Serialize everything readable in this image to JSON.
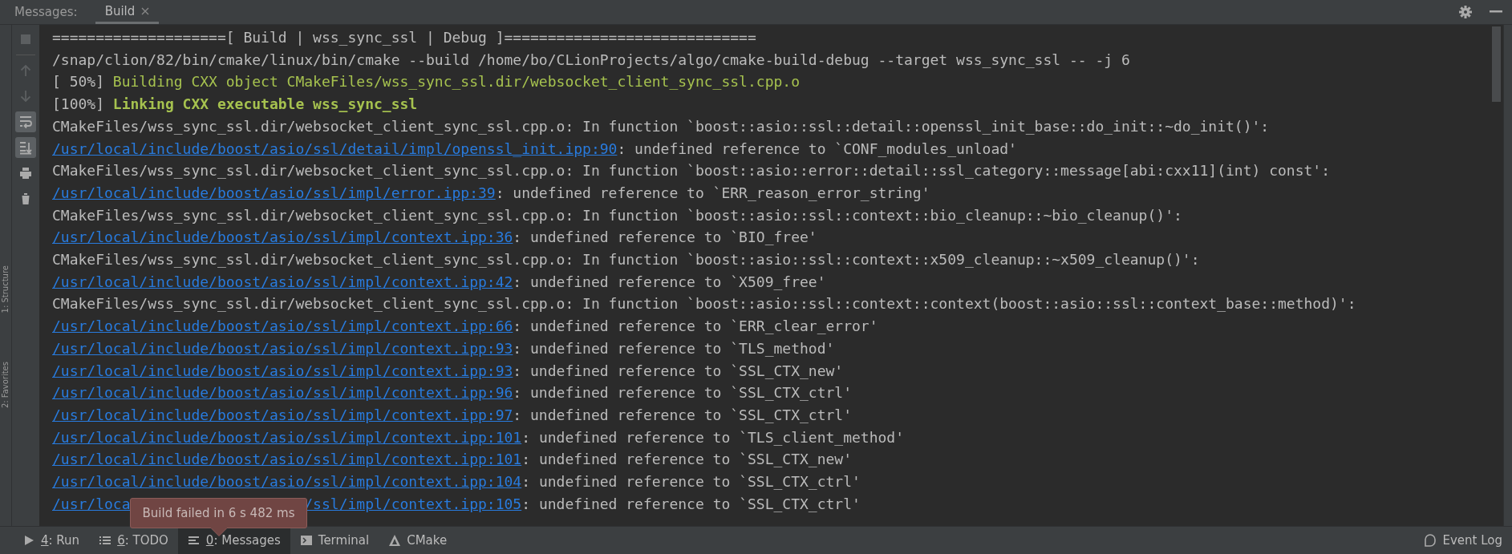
{
  "tool_window": {
    "title": "Messages:",
    "tabs": [
      {
        "label": "Build",
        "selected": true,
        "closable": true
      }
    ]
  },
  "side_strip": [
    {
      "label": "1: Structure"
    },
    {
      "label": "2: Favorites"
    }
  ],
  "toolbar": [
    {
      "kind": "stop",
      "disabled": true,
      "selected": false
    },
    {
      "kind": "up",
      "disabled": true,
      "selected": false
    },
    {
      "kind": "down",
      "disabled": true,
      "selected": false
    },
    {
      "kind": "wrap",
      "disabled": false,
      "selected": true
    },
    {
      "kind": "scroll_end",
      "disabled": false,
      "selected": true
    },
    {
      "kind": "print",
      "disabled": false,
      "selected": false
    },
    {
      "kind": "trash",
      "disabled": false,
      "selected": false
    }
  ],
  "lines": [
    {
      "kind": "text",
      "text": "====================[ Build | wss_sync_ssl | Debug ]============================="
    },
    {
      "kind": "text",
      "text": "/snap/clion/82/bin/cmake/linux/bin/cmake --build /home/bo/CLionProjects/algo/cmake-build-debug --target wss_sync_ssl -- -j 6"
    },
    {
      "kind": "progress",
      "prefix": "[ 50%]",
      "text": "Building CXX object CMakeFiles/wss_sync_ssl.dir/websocket_client_sync_ssl.cpp.o",
      "bold": false
    },
    {
      "kind": "progress",
      "prefix": "[100%]",
      "text": "Linking CXX executable wss_sync_ssl",
      "bold": true
    },
    {
      "kind": "text",
      "text": "CMakeFiles/wss_sync_ssl.dir/websocket_client_sync_ssl.cpp.o: In function `boost::asio::ssl::detail::openssl_init_base::do_init::~do_init()':"
    },
    {
      "kind": "link",
      "links": [
        "/usr/local/include/boost/asio/ssl/detail/impl/openssl_init.ipp:90"
      ],
      "text": ": undefined reference to `CONF_modules_unload'"
    },
    {
      "kind": "text",
      "text": "CMakeFiles/wss_sync_ssl.dir/websocket_client_sync_ssl.cpp.o: In function `boost::asio::error::detail::ssl_category::message[abi:cxx11](int) const':"
    },
    {
      "kind": "link",
      "links": [
        "/usr/local/include/boost/asio/ssl/impl/error.ipp:39"
      ],
      "text": ": undefined reference to `ERR_reason_error_string'"
    },
    {
      "kind": "text",
      "text": "CMakeFiles/wss_sync_ssl.dir/websocket_client_sync_ssl.cpp.o: In function `boost::asio::ssl::context::bio_cleanup::~bio_cleanup()':"
    },
    {
      "kind": "link",
      "links": [
        "/usr/local/include/boost/asio/ssl/impl/context.ipp:36"
      ],
      "text": ": undefined reference to `BIO_free'"
    },
    {
      "kind": "text",
      "text": "CMakeFiles/wss_sync_ssl.dir/websocket_client_sync_ssl.cpp.o: In function `boost::asio::ssl::context::x509_cleanup::~x509_cleanup()':"
    },
    {
      "kind": "link",
      "links": [
        "/usr/local/include/boost/asio/ssl/impl/context.ipp:42"
      ],
      "text": ": undefined reference to `X509_free'"
    },
    {
      "kind": "text",
      "text": "CMakeFiles/wss_sync_ssl.dir/websocket_client_sync_ssl.cpp.o: In function `boost::asio::ssl::context::context(boost::asio::ssl::context_base::method)':"
    },
    {
      "kind": "link",
      "links": [
        "/usr/local/include/boost/asio/ssl/impl/context.ipp:66"
      ],
      "text": ": undefined reference to `ERR_clear_error'"
    },
    {
      "kind": "link",
      "links": [
        "/usr/local/include/boost/asio/ssl/impl/context.ipp:93"
      ],
      "text": ": undefined reference to `TLS_method'"
    },
    {
      "kind": "link",
      "links": [
        "/usr/local/include/boost/asio/ssl/impl/context.ipp:93"
      ],
      "text": ": undefined reference to `SSL_CTX_new'"
    },
    {
      "kind": "link",
      "links": [
        "/usr/local/include/boost/asio/ssl/impl/context.ipp:96"
      ],
      "text": ": undefined reference to `SSL_CTX_ctrl'"
    },
    {
      "kind": "link",
      "links": [
        "/usr/local/include/boost/asio/ssl/impl/context.ipp:97"
      ],
      "text": ": undefined reference to `SSL_CTX_ctrl'"
    },
    {
      "kind": "link",
      "links": [
        "/usr/local/include/boost/asio/ssl/impl/context.ipp:101"
      ],
      "text": ": undefined reference to `TLS_client_method'"
    },
    {
      "kind": "link",
      "links": [
        "/usr/local/include/boost/asio/ssl/impl/context.ipp:101"
      ],
      "text": ": undefined reference to `SSL_CTX_new'"
    },
    {
      "kind": "link",
      "links": [
        "/usr/local/include/boost/asio/ssl/impl/context.ipp:104"
      ],
      "text": ": undefined reference to `SSL_CTX_ctrl'"
    },
    {
      "kind": "link",
      "links": [
        "/usr/loca",
        "/ssl/impl/context.ipp:105"
      ],
      "text": ": undefined reference to `SSL_CTX_ctrl'"
    }
  ],
  "tooltip": {
    "text": "Build failed in 6 s 482 ms"
  },
  "bottom_tabs": [
    {
      "kind": "run",
      "mnemonic": "4",
      "label": ": Run",
      "selected": false
    },
    {
      "kind": "todo",
      "mnemonic": "6",
      "label": ": TODO",
      "selected": false
    },
    {
      "kind": "messages",
      "mnemonic": "0",
      "label": ": Messages",
      "selected": true
    },
    {
      "kind": "terminal",
      "label": "Terminal",
      "selected": false
    },
    {
      "kind": "cmake",
      "label": "CMake",
      "selected": false
    }
  ],
  "event_log": {
    "label": "Event Log"
  }
}
